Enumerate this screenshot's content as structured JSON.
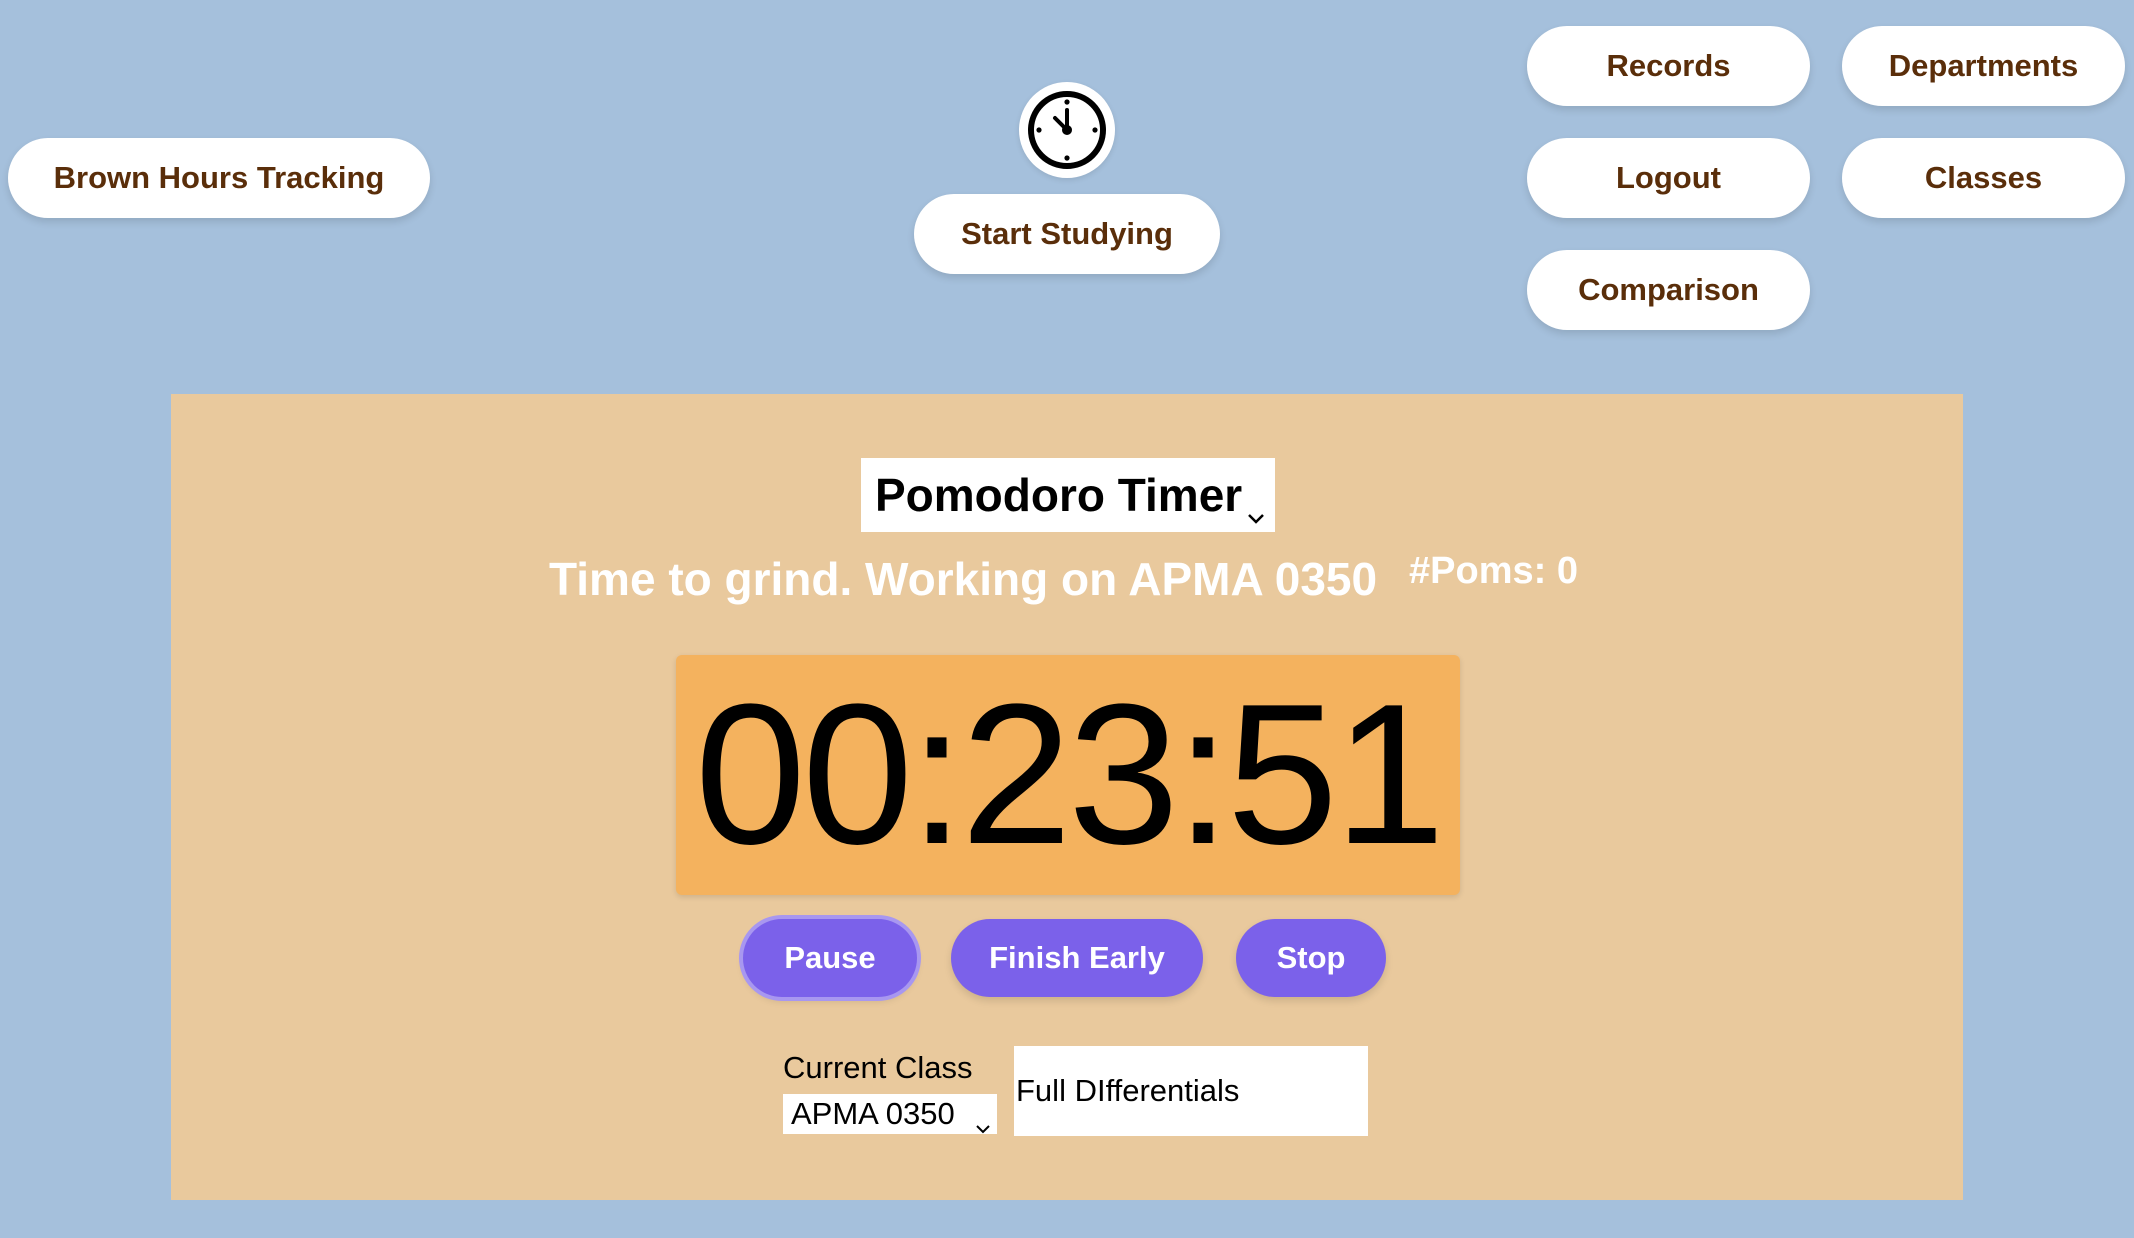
{
  "header": {
    "brand": "Brown Hours Tracking",
    "start_button": "Start Studying",
    "clock_icon": "clock-icon"
  },
  "nav": {
    "records": "Records",
    "departments": "Departments",
    "logout": "Logout",
    "classes": "Classes",
    "comparison": "Comparison"
  },
  "timer": {
    "mode_selected": "Pomodoro Timer",
    "status": "Time to grind. Working on APMA 0350",
    "poms": "#Poms: 0",
    "display": "00:23:51"
  },
  "actions": {
    "pause": "Pause",
    "finish_early": "Finish Early",
    "stop": "Stop"
  },
  "class_picker": {
    "label": "Current Class",
    "selected": "APMA 0350",
    "description_value": "Full DIfferentials"
  },
  "colors": {
    "background": "#a5c0dc",
    "panel": "#e9c99d",
    "timer_box": "#f4b25e",
    "action_button": "#7b61ea",
    "header_text": "#5a2e0a"
  }
}
